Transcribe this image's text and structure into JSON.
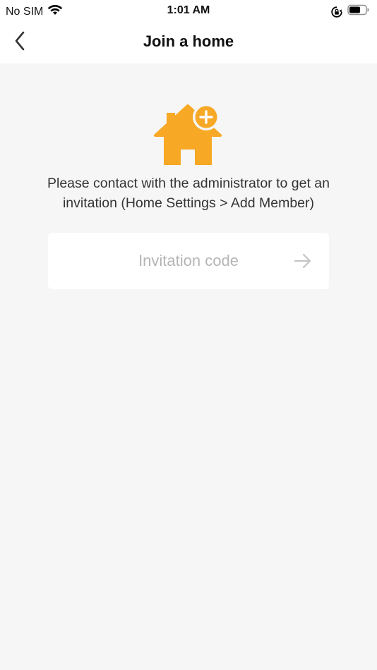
{
  "status_bar": {
    "carrier": "No SIM",
    "time": "1:01 AM",
    "icons": [
      "wifi-icon",
      "rotation-lock-icon",
      "battery-icon"
    ]
  },
  "nav": {
    "back_icon": "chevron-left-icon",
    "title": "Join a home"
  },
  "main": {
    "illustration_icon": "house-add-icon",
    "accent_color": "#F7A825",
    "description_line1": "Please contact with the administrator to get an",
    "description_line2": "invitation (Home Settings > Add Member)",
    "invitation_code": {
      "value": "",
      "placeholder": "Invitation code"
    },
    "submit_icon": "arrow-right-icon"
  }
}
